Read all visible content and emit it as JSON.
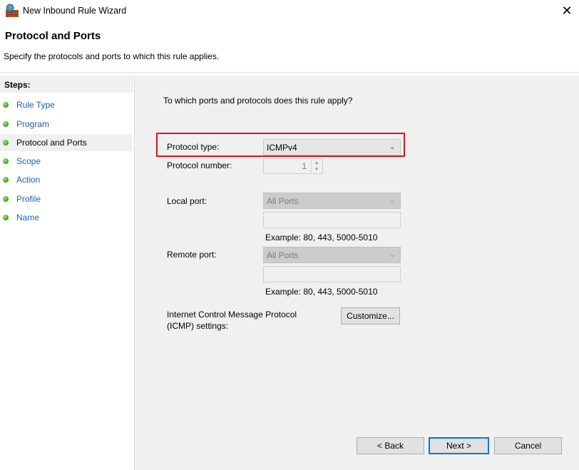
{
  "window": {
    "title": "New Inbound Rule Wizard",
    "close_glyph": "✕"
  },
  "header": {
    "title": "Protocol and Ports",
    "subtitle": "Specify the protocols and ports to which this rule applies."
  },
  "steps": {
    "title": "Steps:",
    "items": [
      {
        "label": "Rule Type",
        "active": false
      },
      {
        "label": "Program",
        "active": false
      },
      {
        "label": "Protocol and Ports",
        "active": true
      },
      {
        "label": "Scope",
        "active": false
      },
      {
        "label": "Action",
        "active": false
      },
      {
        "label": "Profile",
        "active": false
      },
      {
        "label": "Name",
        "active": false
      }
    ]
  },
  "content": {
    "question": "To which ports and protocols does this rule apply?",
    "protocol_type": {
      "label": "Protocol type:",
      "value": "ICMPv4"
    },
    "protocol_number": {
      "label": "Protocol number:",
      "value": "1"
    },
    "local_port": {
      "label": "Local port:",
      "value": "All Ports",
      "text": "",
      "example": "Example: 80, 443, 5000-5010"
    },
    "remote_port": {
      "label": "Remote port:",
      "value": "All Ports",
      "text": "",
      "example": "Example: 80, 443, 5000-5010"
    },
    "icmp": {
      "label_line1": "Internet Control Message Protocol",
      "label_line2": "(ICMP) settings:",
      "button": "Customize..."
    }
  },
  "footer": {
    "back": "< Back",
    "next": "Next >",
    "cancel": "Cancel"
  },
  "colors": {
    "highlight": "#e0101a",
    "link": "#1e5fb4",
    "step_dot": "#4aa82c"
  }
}
